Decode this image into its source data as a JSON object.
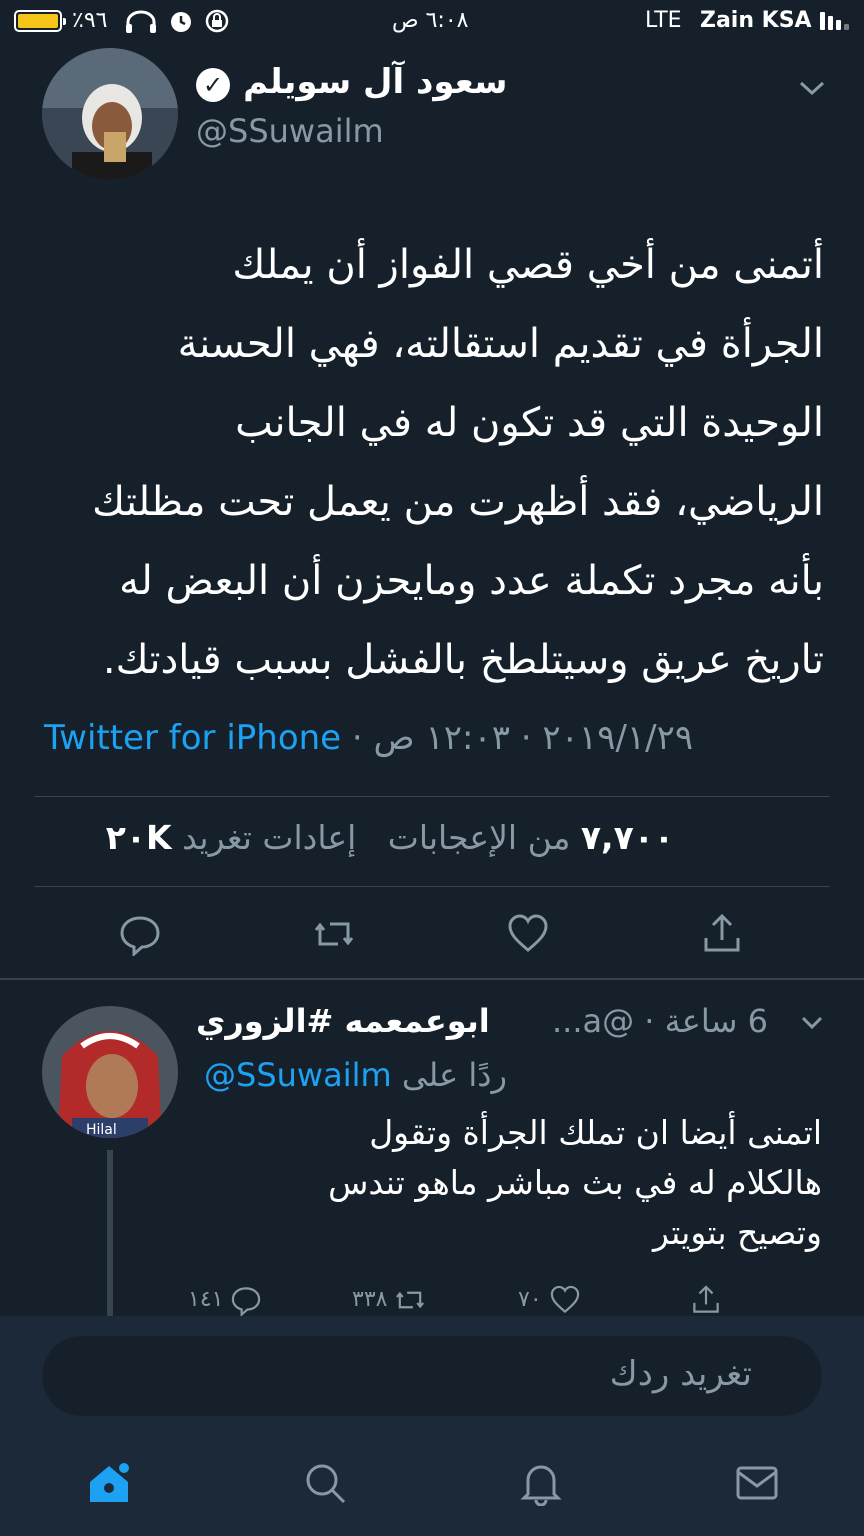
{
  "status_bar": {
    "battery_label": "٪٩٦",
    "time": "٦:٠٨ ص",
    "network": "LTE",
    "carrier": "Zain KSA",
    "battery_level": 0.96,
    "icons": [
      "headphones-icon",
      "alarm-icon",
      "rotation-lock-icon",
      "signal-icon"
    ]
  },
  "tweet": {
    "author_name": "سعود آل سويلم",
    "author_handle": "@SSuwailm",
    "verified": true,
    "text": "أتمنى من أخي قصي الفواز  أن يملك\nالجرأة في تقديم استقالته، فهي الحسنة\nالوحيدة التي قد تكون له في الجانب\nالرياضي، فقد أظهرت من يعمل تحت مظلتك\nبأنه مجرد تكملة عدد ومايحزن أن البعض له\nتاريخ عريق وسيتلطخ بالفشل بسبب قيادتك.",
    "source": "Twitter for iPhone",
    "separator": "·",
    "date": "٢٠١٩/١/٢٩",
    "time": "١٢:٠٣ ص",
    "retweets_count": "٢٠K",
    "retweets_label": "إعادات تغريد",
    "likes_count": "٧,٧٠٠",
    "likes_label": "من الإعجابات"
  },
  "reply": {
    "author_name": "ابوعمعمه #الزوري",
    "author_handle": "@a...",
    "time_ago": "6 ساعة",
    "replying_to_label": "ردًا على",
    "replying_to_handle": "@SSuwailm",
    "avatar_caption": "Hilal",
    "text": "اتمنى أيضا ان تملك الجرأة وتقول\nهالكلام له في بث مباشر ماهو تندس\nوتصيح بتويتر",
    "reply_count": "١٤١",
    "retweet_count": "٣٣٨",
    "like_count": "٧٠"
  },
  "compose": {
    "placeholder": "تغريد ردك"
  },
  "nav": {
    "items": [
      "home-icon",
      "search-icon",
      "notifications-icon",
      "messages-icon"
    ]
  },
  "colors": {
    "background": "#15202b",
    "accent": "#1da1f2",
    "muted": "#8899a6",
    "divider": "#38444d",
    "battery": "#f5c518"
  }
}
